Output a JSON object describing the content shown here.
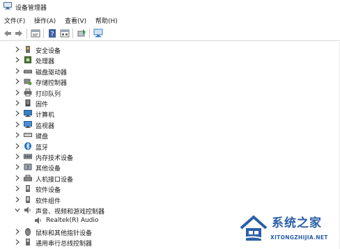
{
  "window": {
    "title": "设备管理器"
  },
  "menu": [
    {
      "label": "文件(F)"
    },
    {
      "label": "操作(A)"
    },
    {
      "label": "查看(V)"
    },
    {
      "label": "帮助(H)"
    }
  ],
  "tree": {
    "items": [
      {
        "label": "安全设备",
        "icon": "security-device-icon",
        "expanded": false
      },
      {
        "label": "处理器",
        "icon": "processor-icon",
        "expanded": false
      },
      {
        "label": "磁盘驱动器",
        "icon": "disk-drive-icon",
        "expanded": false
      },
      {
        "label": "存储控制器",
        "icon": "storage-controller-icon",
        "expanded": false
      },
      {
        "label": "打印队列",
        "icon": "printer-icon",
        "expanded": false
      },
      {
        "label": "固件",
        "icon": "firmware-icon",
        "expanded": false
      },
      {
        "label": "计算机",
        "icon": "computer-icon",
        "expanded": false
      },
      {
        "label": "监视器",
        "icon": "monitor-icon",
        "expanded": false
      },
      {
        "label": "键盘",
        "icon": "keyboard-icon",
        "expanded": false
      },
      {
        "label": "蓝牙",
        "icon": "bluetooth-icon",
        "expanded": false
      },
      {
        "label": "内存技术设备",
        "icon": "memory-device-icon",
        "expanded": false
      },
      {
        "label": "其他设备",
        "icon": "other-device-icon",
        "expanded": false
      },
      {
        "label": "人机接口设备",
        "icon": "hid-icon",
        "expanded": false
      },
      {
        "label": "软件设备",
        "icon": "software-device-icon",
        "expanded": false
      },
      {
        "label": "软件组件",
        "icon": "software-component-icon",
        "expanded": false
      },
      {
        "label": "声音、视频和游戏控制器",
        "icon": "sound-icon",
        "expanded": true
      },
      {
        "label": "Realtek(R) Audio",
        "icon": "speaker-icon",
        "child": true
      },
      {
        "label": "鼠标和其他指针设备",
        "icon": "mouse-icon",
        "expanded": false
      },
      {
        "label": "通用串行总线控制器",
        "icon": "usb-icon",
        "expanded": false
      }
    ]
  },
  "watermark": {
    "text": "系统之家",
    "url": "XITONGZHIJIA.NET"
  },
  "colors": {
    "accent": "#2a5fa8",
    "icon_blue": "#3b7fc4"
  }
}
